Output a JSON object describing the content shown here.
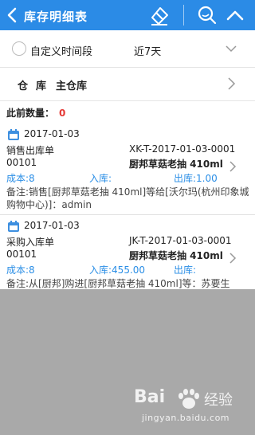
{
  "header": {
    "title": "库存明细表",
    "bg_color": "#2b8be6"
  },
  "filters": {
    "custom_range_label": "自定义时间段",
    "range_value": "近7天",
    "warehouse_label": "仓库",
    "warehouse_value": "主仓库"
  },
  "prior_count": {
    "label": "此前数量：",
    "value": "0"
  },
  "records": [
    {
      "date": "2017-01-03",
      "type": "销售出库单",
      "code": "XK-T-2017-01-03-0001",
      "product_code": "00101",
      "product_name": "厨邦草菇老抽 410ml",
      "cost": "成本:8",
      "in": "入库:",
      "out": "出库:1.00",
      "note": "备注:销售[厨邦草菇老抽 410ml]等给[沃尔玛(杭州印象城购物中心)]：admin"
    },
    {
      "date": "2017-01-03",
      "type": "采购入库单",
      "code": "JK-T-2017-01-03-0001",
      "product_code": "00101",
      "product_name": "厨邦草菇老抽 410ml",
      "cost": "成本:8",
      "in": "入库:455.00",
      "out": "出库:",
      "note": "备注:从[厨邦]购进[厨邦草菇老抽 410ml]等：苏要生"
    }
  ],
  "watermark": {
    "brand_left": "Bai",
    "brand_right": "经验",
    "url": "jingyan.baidu.com"
  }
}
